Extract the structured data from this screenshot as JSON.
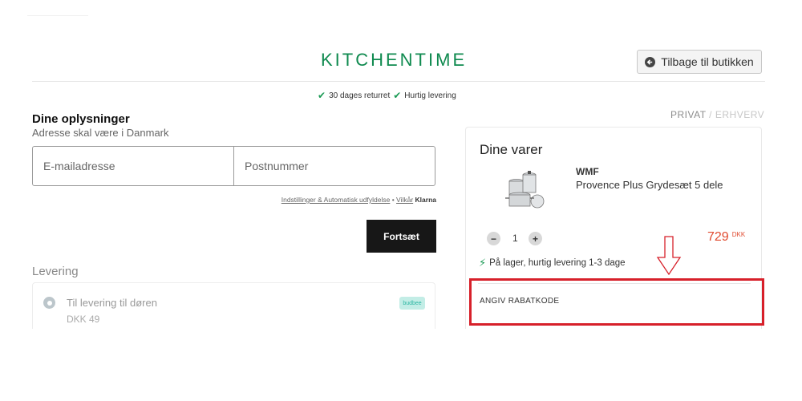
{
  "header": {
    "logo": "KITCHENTIME",
    "back_label": "Tilbage til butikken",
    "trust": [
      "30 dages returret",
      "Hurtig levering"
    ]
  },
  "info": {
    "title": "Dine oplysninger",
    "subtitle": "Adresse skal være i Danmark",
    "email_placeholder": "E-mailadresse",
    "postal_placeholder": "Postnummer",
    "legal_link1": "Indstillinger & Automatisk udfyldelse",
    "legal_sep": " • ",
    "legal_link2": "Vilkår",
    "legal_brand": "Klarna",
    "continue_label": "Fortsæt"
  },
  "delivery": {
    "title": "Levering",
    "option_label": "Til levering til døren",
    "option_price": "DKK 49",
    "carrier": "budbee"
  },
  "customer_type": {
    "active": "PRIVAT",
    "separator": " / ",
    "inactive": "ERHVERV"
  },
  "cart": {
    "title": "Dine varer",
    "brand": "WMF",
    "product": "Provence Plus Grydesæt 5 dele",
    "quantity": "1",
    "price": "729",
    "currency": "DKK",
    "stock": "På lager, hurtig levering 1-3 dage",
    "discount_label": "ANGIV RABATKODE"
  },
  "colors": {
    "brand_green": "#0f8a4f",
    "price_red": "#e04a2f",
    "highlight_red": "#d7202a",
    "button_dark": "#171717"
  },
  "icons": {
    "back": "arrow-left-circle-icon",
    "check": "checkmark-icon",
    "stock": "lightning-icon",
    "annotation": "down-arrow-icon"
  }
}
